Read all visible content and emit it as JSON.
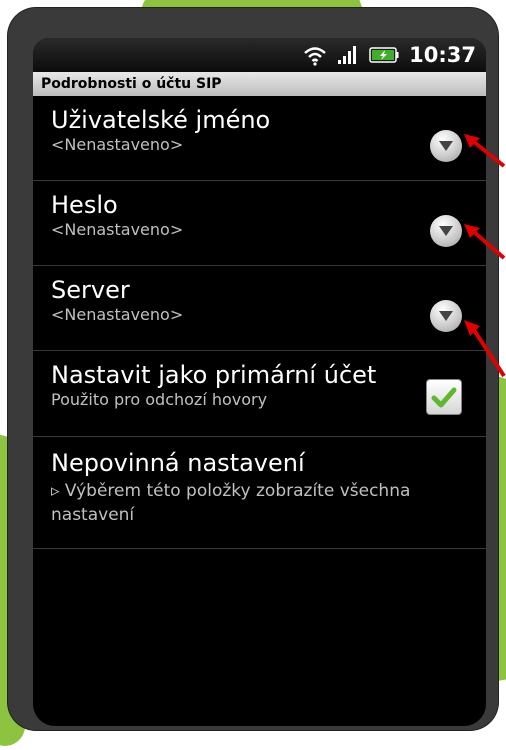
{
  "status_bar": {
    "time": "10:37",
    "icons": [
      "wifi-icon",
      "signal-icon",
      "battery-charging-icon"
    ]
  },
  "title": "Podrobnosti o účtu SIP",
  "items": [
    {
      "title": "Uživatelské jméno",
      "subtitle": "<Nenastaveno>",
      "control": "dropdown-icon"
    },
    {
      "title": "Heslo",
      "subtitle": "<Nenastaveno>",
      "control": "dropdown-icon"
    },
    {
      "title": "Server",
      "subtitle": "<Nenastaveno>",
      "control": "dropdown-icon"
    },
    {
      "title": "Nastavit jako primární účet",
      "subtitle": "Použito pro odchozí hovory",
      "control": "checkbox",
      "checked": true
    },
    {
      "title": "Nepovinná nastavení",
      "subtitle": "▹ Výběrem této položky zobrazíte všechna nastavení"
    }
  ],
  "colors": {
    "accent_green": "#8dc43f",
    "annotation_red": "#e00000",
    "check_green": "#5fb82f"
  }
}
